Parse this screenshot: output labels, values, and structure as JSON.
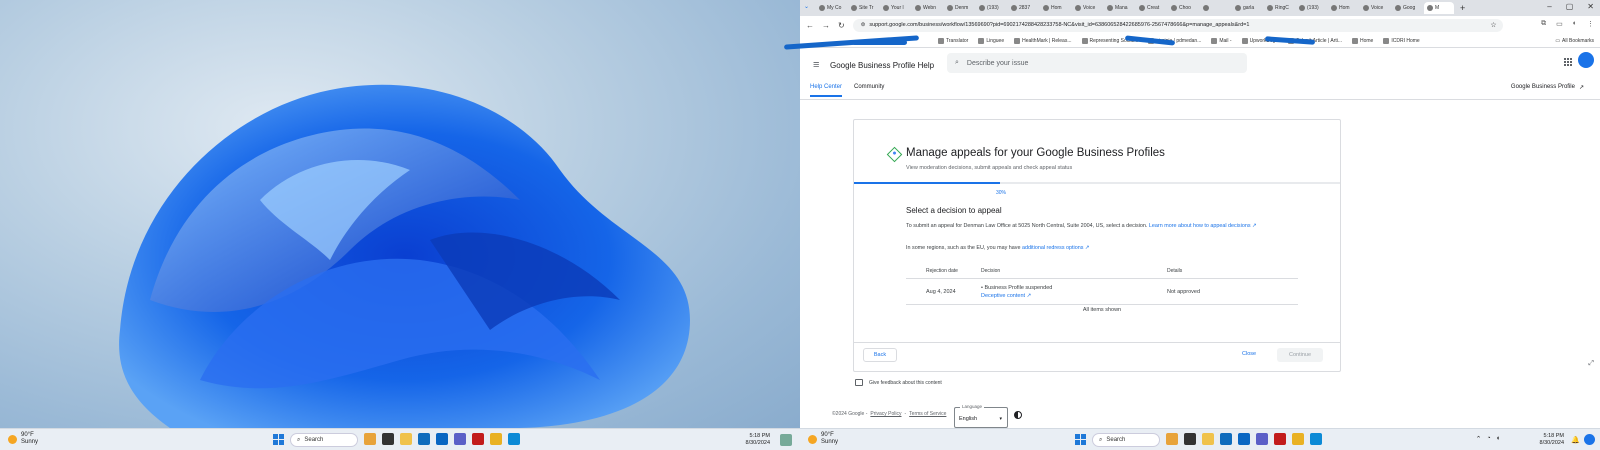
{
  "desktop": {
    "weather_temp": "90°F",
    "weather_cond": "Sunny",
    "search_label": "Search",
    "time": "5:18 PM",
    "date": "8/30/2024"
  },
  "browser": {
    "tabs": [
      "My Co",
      "Site Tr",
      "Your l",
      "Webn",
      "Denm",
      "(193)",
      "2837",
      "Hom",
      "Voice",
      "Mana",
      "Creat",
      "Choo",
      "",
      "garla",
      "RingC",
      "(193)",
      "Hom",
      "Voice",
      "Goog",
      "M"
    ],
    "url": "support.google.com/business/workflow/13569690?pid=6902174288428233758-NC&visit_id=638606528422685976-2567478666&p=manage_appeals&rd=1",
    "bookmarks": [
      "Translator",
      "Linguee",
      "HealthMark | Releas...",
      "Representing Social...",
      "virginia | pdmedan...",
      "Mail -",
      "UpworkBogs",
      "Submit Article | Arti...",
      "Home",
      "ICDRI Home"
    ],
    "all_bookmarks": "All Bookmarks"
  },
  "help": {
    "product_title": "Google Business Profile Help",
    "search_placeholder": "Describe your issue",
    "tab_help_center": "Help Center",
    "tab_community": "Community",
    "gbp_link": "Google Business Profile"
  },
  "card": {
    "title": "Manage appeals for your Google Business Profiles",
    "subtitle": "View moderation decisions, submit appeals and check appeal status",
    "progress_label": "30%",
    "progress_value": 0.3,
    "section_title": "Select a decision to appeal",
    "para1_text": "To submit an appeal for Denman Law Office at 5025 North Central, Suite 2004, US, select a decision. ",
    "para1_link": "Learn more about how to appeal decisions",
    "para2_text": "In some regions, such as the EU, you may have ",
    "para2_link": "additional redress options",
    "table": {
      "headers": [
        "Rejection date",
        "Decision",
        "Details"
      ],
      "rows": [
        {
          "date": "Aug 4, 2024",
          "decision": "• Business Profile suspended",
          "decision_link": "Deceptive content",
          "details": "Not approved"
        }
      ]
    },
    "items_shown": "All items shown",
    "back": "Back",
    "close": "Close",
    "continue": "Continue"
  },
  "page_footer": {
    "feedback": "Give feedback about this content",
    "copyright": "©2024 Google -",
    "privacy": "Privacy Policy",
    "sep": "-",
    "terms": "Terms of Service",
    "language_label": "Language",
    "language_value": "English"
  }
}
